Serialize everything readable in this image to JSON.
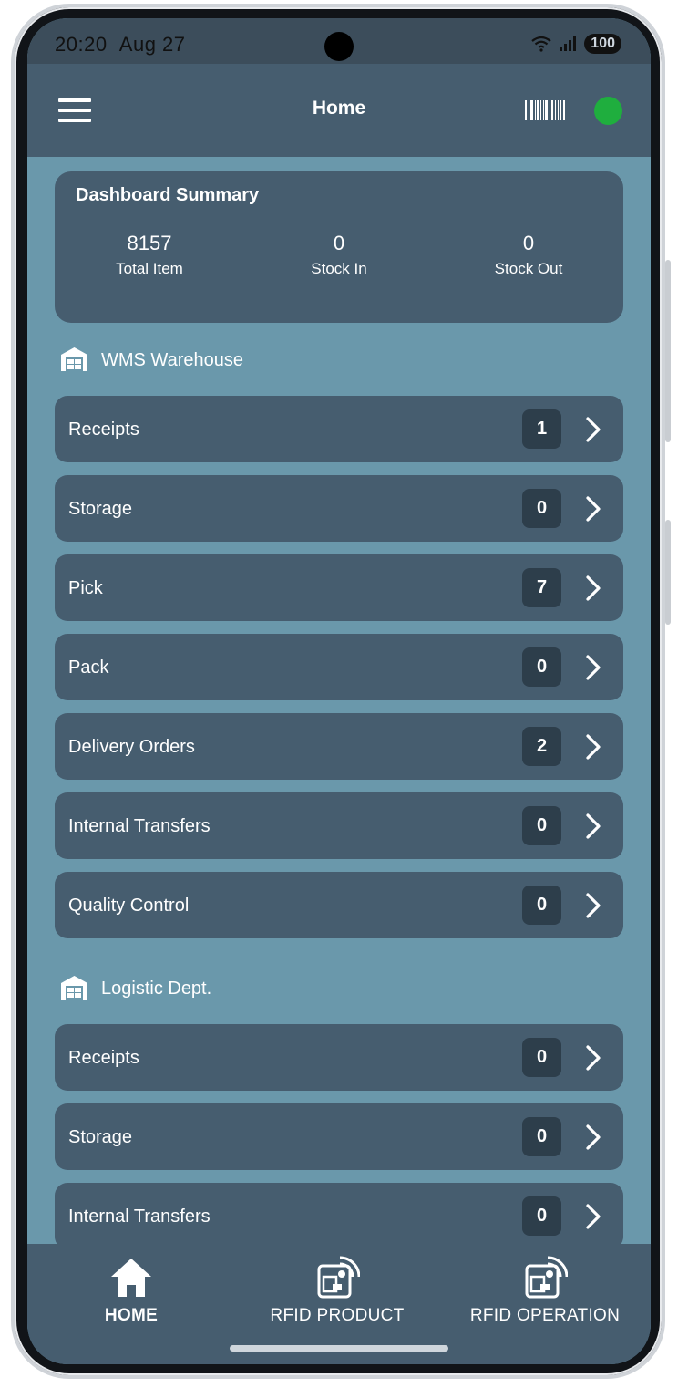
{
  "status_bar": {
    "time": "20:20",
    "date": "Aug 27",
    "battery": "100"
  },
  "app_bar": {
    "title": "Home",
    "connection_color": "#1fae3e"
  },
  "dashboard": {
    "title": "Dashboard Summary",
    "stats": [
      {
        "value": "8157",
        "label": "Total Item"
      },
      {
        "value": "0",
        "label": "Stock In"
      },
      {
        "value": "0",
        "label": "Stock Out"
      }
    ]
  },
  "warehouses": [
    {
      "name": "WMS Warehouse",
      "icon": "warehouse-icon",
      "operations": [
        {
          "label": "Receipts",
          "count": "1"
        },
        {
          "label": "Storage",
          "count": "0"
        },
        {
          "label": "Pick",
          "count": "7"
        },
        {
          "label": "Pack",
          "count": "0"
        },
        {
          "label": "Delivery Orders",
          "count": "2"
        },
        {
          "label": "Internal Transfers",
          "count": "0"
        },
        {
          "label": "Quality Control",
          "count": "0"
        }
      ]
    },
    {
      "name": "Logistic Dept.",
      "icon": "warehouse-icon",
      "operations": [
        {
          "label": "Receipts",
          "count": "0"
        },
        {
          "label": "Storage",
          "count": "0"
        },
        {
          "label": "Internal Transfers",
          "count": "0"
        }
      ]
    }
  ],
  "bottom_nav": {
    "home": "HOME",
    "rfid_product": "RFID PRODUCT",
    "rfid_operation": "RFID OPERATION"
  },
  "colors": {
    "background": "#6a98ab",
    "card": "#465d6f",
    "badge": "#2d3e4b"
  }
}
